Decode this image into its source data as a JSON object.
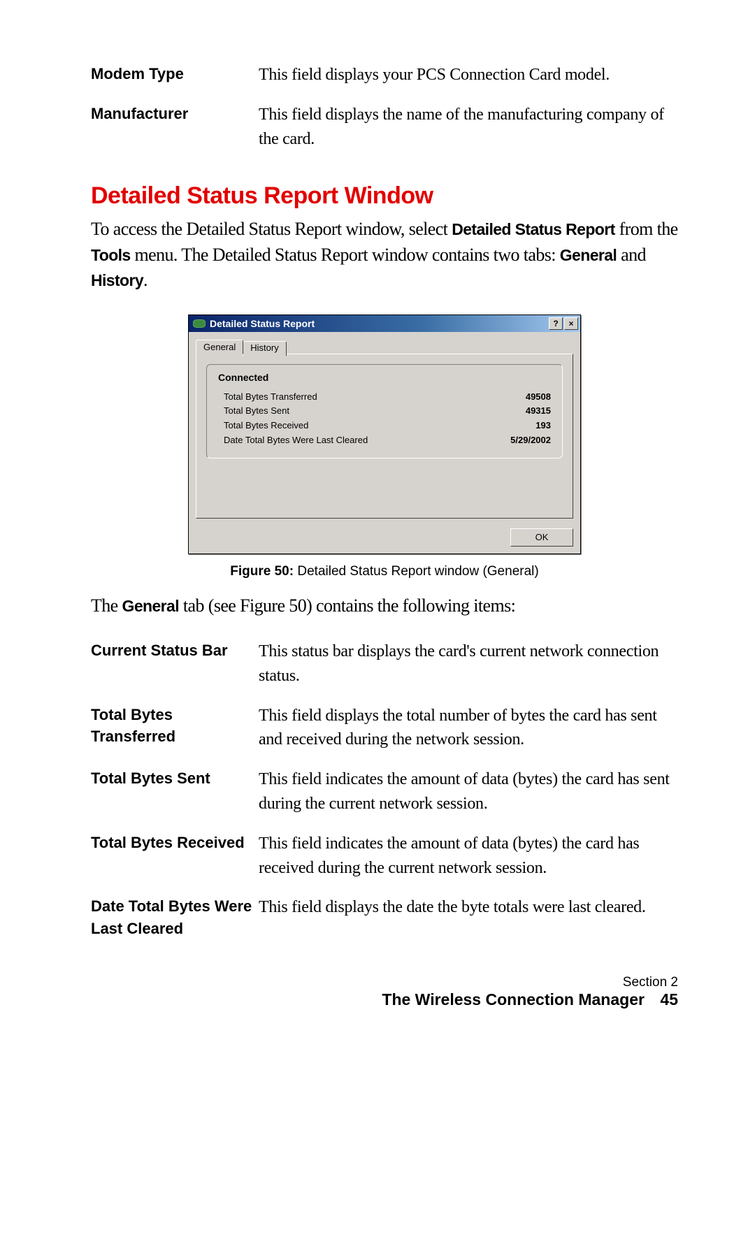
{
  "top_defs": [
    {
      "term": "Modem Type",
      "desc": "This field displays your PCS Connection Card model."
    },
    {
      "term": "Manufacturer",
      "desc": "This field displays the name of the manufacturing company of the card."
    }
  ],
  "section_heading": "Detailed Status Report Window",
  "intro": {
    "p1a": "To access the Detailed Status Report window, select ",
    "b1": "Detailed Status Report",
    "p1b": " from the ",
    "b2": "Tools",
    "p1c": " menu. The Detailed Status Report window contains two tabs: ",
    "b3": "General",
    "p1d": " and ",
    "b4": "History",
    "p1e": "."
  },
  "dialog": {
    "title": "Detailed Status Report",
    "help_glyph": "?",
    "close_glyph": "×",
    "tabs": {
      "general": "General",
      "history": "History"
    },
    "status_label": "Connected",
    "rows": [
      {
        "label": "Total Bytes Transferred",
        "value": "49508"
      },
      {
        "label": "Total Bytes Sent",
        "value": "49315"
      },
      {
        "label": "Total Bytes Received",
        "value": "193"
      },
      {
        "label": "Date Total Bytes Were Last Cleared",
        "value": "5/29/2002"
      }
    ],
    "ok_label": "OK"
  },
  "figure_caption": {
    "bold": "Figure 50:",
    "rest": " Detailed Status Report window (General)"
  },
  "post_figure": {
    "a": "The ",
    "b": "General",
    "c": " tab (see Figure 50) contains the following items:"
  },
  "bottom_defs": [
    {
      "term": "Current Status Bar",
      "desc": "This status bar displays the card's current network connection status."
    },
    {
      "term": "Total Bytes Transferred",
      "desc": "This field displays the total number of bytes the card has sent and received during the network session."
    },
    {
      "term": "Total Bytes Sent",
      "desc": "This field indicates the amount of data (bytes) the card has sent during the current network session."
    },
    {
      "term": "Total Bytes Received",
      "desc": "This field indicates the amount of data (bytes) the card has received during the current network session."
    },
    {
      "term": "Date Total Bytes Were Last Cleared",
      "desc": "This field displays the date the byte totals were last cleared."
    }
  ],
  "footer": {
    "section": "Section 2",
    "title": "The Wireless Connection Manager",
    "page": "45"
  }
}
